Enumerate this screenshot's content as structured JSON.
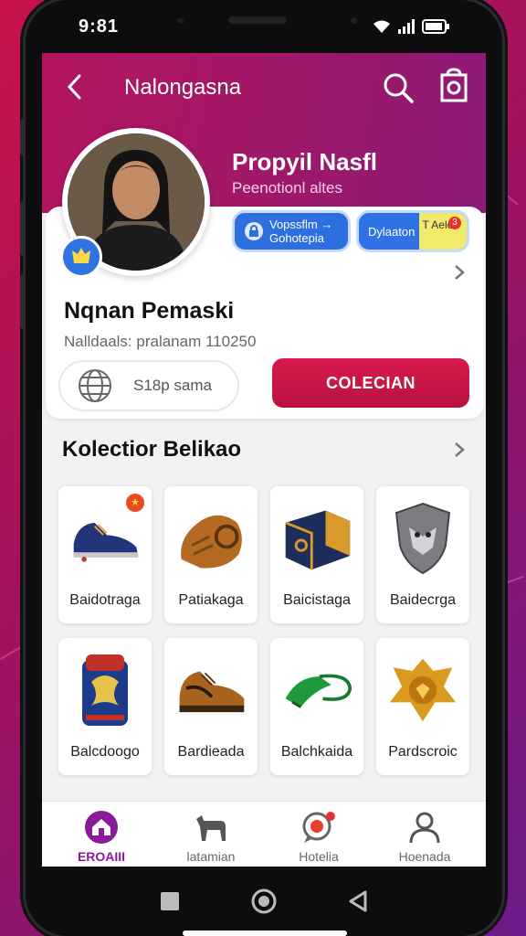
{
  "status": {
    "time": "9:81"
  },
  "header": {
    "title": "Nalongasna"
  },
  "profile": {
    "name": "Propyil Nasfl",
    "subtitle": "Peenotionl altes"
  },
  "pills": {
    "a": "Vopssflm → Gohotepia",
    "b": "Dylaaton",
    "b_side": "T Aelen",
    "b_badge": "3"
  },
  "user": {
    "name": "Nqnan Pemaski",
    "meta": "Nalldaals: pralanam 110250"
  },
  "actions": {
    "globe_label": "S18p sama",
    "collect_label": "COLECIAN"
  },
  "section": {
    "title": "Kolectior Belikao"
  },
  "items": [
    {
      "label": "Baidotraga",
      "icon": "sneaker-icon",
      "tag": "★"
    },
    {
      "label": "Patiakaga",
      "icon": "satchel-icon"
    },
    {
      "label": "Baicistaga",
      "icon": "crate-icon"
    },
    {
      "label": "Baidecrga",
      "icon": "shield-icon"
    },
    {
      "label": "Balcdoogo",
      "icon": "backpack-icon"
    },
    {
      "label": "Bardieada",
      "icon": "boot-icon"
    },
    {
      "label": "Balchkaida",
      "icon": "rope-icon"
    },
    {
      "label": "Pardscroic",
      "icon": "emblem-icon"
    }
  ],
  "tabs": [
    {
      "label": "EROAIII",
      "icon": "home-icon"
    },
    {
      "label": "latamian",
      "icon": "animal-icon"
    },
    {
      "label": "Hotelia",
      "icon": "chat-icon"
    },
    {
      "label": "Hoenada",
      "icon": "person-icon"
    }
  ],
  "colors": {
    "accent": "#d81a4c",
    "header": "#a01868",
    "active_tab": "#8a1a9a"
  }
}
